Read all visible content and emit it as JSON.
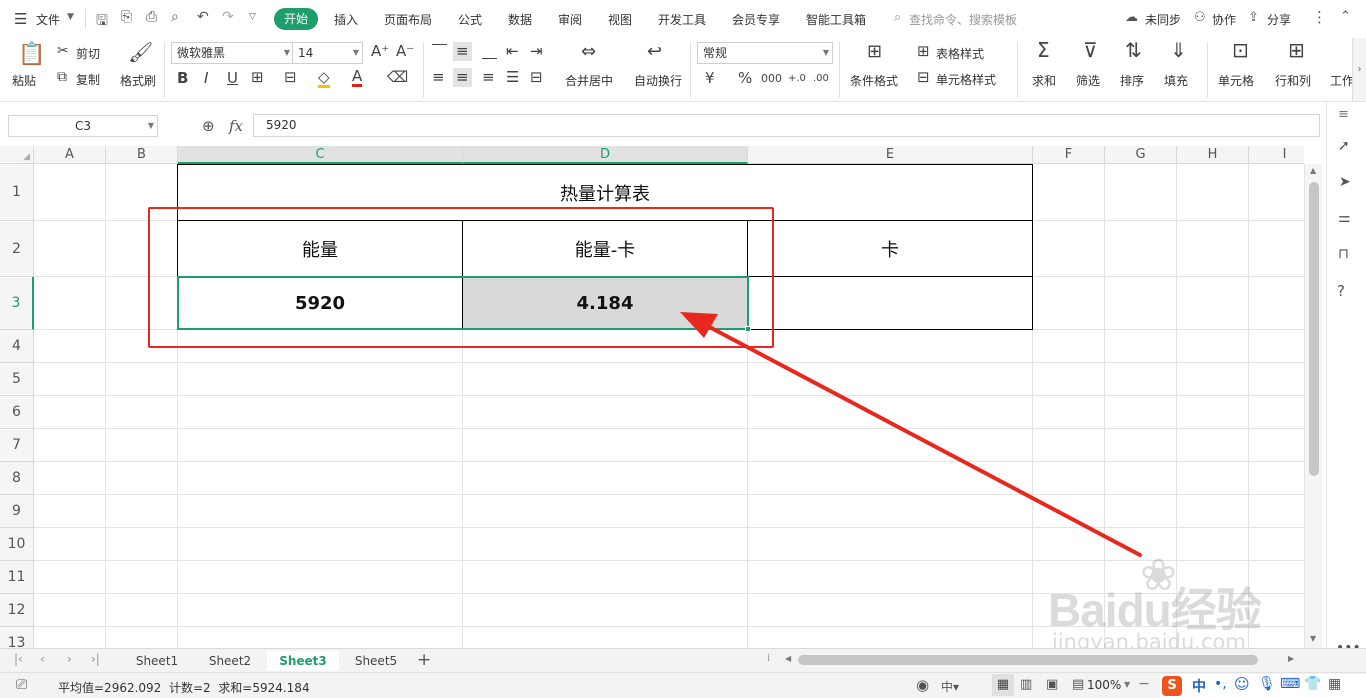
{
  "menu": {
    "file": "文件",
    "tabs": [
      "开始",
      "插入",
      "页面布局",
      "公式",
      "数据",
      "审阅",
      "视图",
      "开发工具",
      "会员专享",
      "智能工具箱"
    ],
    "search_placeholder": "查找命令、搜索模板",
    "sync": "未同步",
    "collab": "协作",
    "share": "分享"
  },
  "ribbon": {
    "paste": "粘贴",
    "cut": "剪切",
    "copy": "复制",
    "format_painter": "格式刷",
    "font_name": "微软雅黑",
    "font_size": "14",
    "bold": "B",
    "italic": "I",
    "underline": "U",
    "merge_center": "合并居中",
    "wrap_text": "自动换行",
    "number_format": "常规",
    "currency": "¥",
    "percent": "%",
    "thousands": "000",
    "inc_decimal": "+.0",
    "dec_decimal": ".00",
    "cond_format": "条件格式",
    "table_style": "表格样式",
    "cell_style": "单元格样式",
    "sum": "求和",
    "filter": "筛选",
    "sort": "排序",
    "fill": "填充",
    "cell": "单元格",
    "row_col": "行和列",
    "worksheet": "工作"
  },
  "formula": {
    "name_box": "C3",
    "fx": "fx",
    "value": "5920"
  },
  "grid": {
    "columns": [
      "A",
      "B",
      "C",
      "D",
      "E",
      "F",
      "G",
      "H",
      "I"
    ],
    "rows": [
      "1",
      "2",
      "3",
      "4",
      "5",
      "6",
      "7",
      "8",
      "9",
      "10",
      "11",
      "12",
      "13"
    ],
    "title": "热量计算表",
    "header_c": "能量",
    "header_d": "能量-卡",
    "header_e": "卡",
    "c3": "5920",
    "d3": "4.184"
  },
  "sheets": [
    "Sheet1",
    "Sheet2",
    "Sheet3",
    "Sheet5"
  ],
  "active_sheet": "Sheet3",
  "status": {
    "summary": "平均值=2962.092  计数=2  求和=5924.184",
    "zoom": "100%",
    "lang": "中"
  },
  "watermark": {
    "brand": "Baidu经验",
    "url": "jingyan.baidu.com"
  },
  "colors": {
    "accent": "#1e9e6a",
    "annotation": "#e8281e",
    "selected_fill": "#d9d9d9"
  }
}
